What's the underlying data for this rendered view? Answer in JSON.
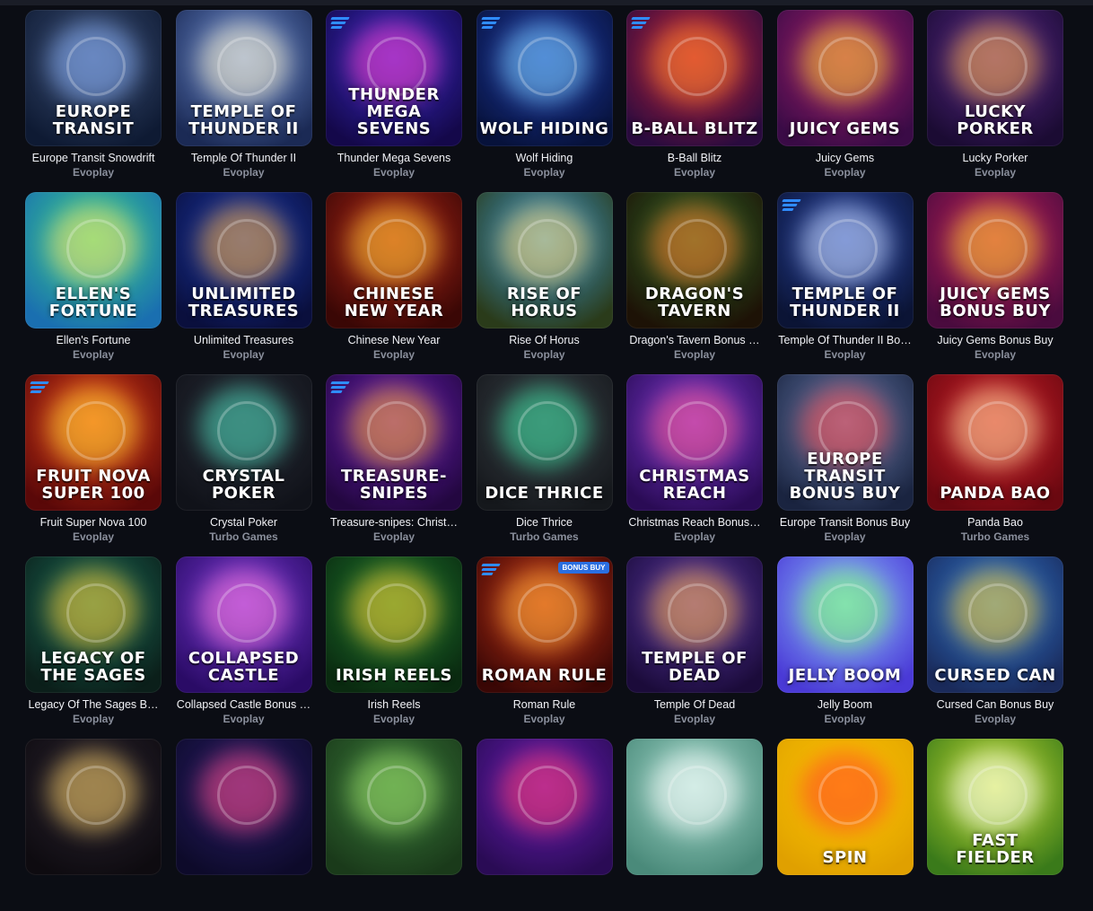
{
  "games": [
    {
      "name": "Europe Transit Snowdrift",
      "provider": "Evoplay",
      "art": "EUROPE TRANSIT",
      "bg": [
        "#3c4f75",
        "#0e1a33"
      ],
      "glow": "#8fb7ff",
      "brand": false,
      "badge": ""
    },
    {
      "name": "Temple Of Thunder II",
      "provider": "Evoplay",
      "art": "TEMPLE OF THUNDER II",
      "bg": [
        "#6e8fd6",
        "#1b2a55"
      ],
      "glow": "#fff3c8",
      "brand": false,
      "badge": ""
    },
    {
      "name": "Thunder Mega Sevens",
      "provider": "Evoplay",
      "art": "THUNDER MEGA SEVENS",
      "bg": [
        "#3a2cc8",
        "#14084a"
      ],
      "glow": "#ff3fc7",
      "brand": true,
      "badge": ""
    },
    {
      "name": "Wolf Hiding",
      "provider": "Evoplay",
      "art": "WOLF HIDING",
      "bg": [
        "#1f3aa6",
        "#07123b"
      ],
      "glow": "#7fd3ff",
      "brand": true,
      "badge": ""
    },
    {
      "name": "B-Ball Blitz",
      "provider": "Evoplay",
      "art": "B-BALL BLITZ",
      "bg": [
        "#c2223a",
        "#2a0b3e"
      ],
      "glow": "#ff8a2b",
      "brand": true,
      "badge": ""
    },
    {
      "name": "Juicy Gems",
      "provider": "Evoplay",
      "art": "JUICY GEMS",
      "bg": [
        "#a81f6e",
        "#3a0b46"
      ],
      "glow": "#ffd12b",
      "brand": false,
      "badge": ""
    },
    {
      "name": "Lucky Porker",
      "provider": "Evoplay",
      "art": "LUCKY PORKER",
      "bg": [
        "#5a2a8c",
        "#1b0b33"
      ],
      "glow": "#ffb347",
      "brand": false,
      "badge": ""
    },
    {
      "name": "Ellen's Fortune",
      "provider": "Evoplay",
      "art": "ELLEN'S FORTUNE",
      "bg": [
        "#3ad38a",
        "#1a6fb0"
      ],
      "glow": "#ffe36b",
      "brand": false,
      "badge": ""
    },
    {
      "name": "Unlimited Treasures",
      "provider": "Evoplay",
      "art": "UNLIMITED TREASURES",
      "bg": [
        "#1b3bb0",
        "#0a0f3d"
      ],
      "glow": "#ffb23b",
      "brand": false,
      "badge": ""
    },
    {
      "name": "Chinese New Year",
      "provider": "Evoplay",
      "art": "CHINESE NEW YEAR",
      "bg": [
        "#b4281a",
        "#3a0705"
      ],
      "glow": "#ffcc33",
      "brand": false,
      "badge": ""
    },
    {
      "name": "Rise Of Horus",
      "provider": "Evoplay",
      "art": "RISE OF HORUS",
      "bg": [
        "#3d9bd6",
        "#2a3b1a"
      ],
      "glow": "#ffd36b",
      "brand": false,
      "badge": ""
    },
    {
      "name": "Dragon's Tavern Bonus …",
      "provider": "Evoplay",
      "art": "DRAGON'S TAVERN",
      "bg": [
        "#2f6a2a",
        "#1d1206"
      ],
      "glow": "#ff7b2b",
      "brand": false,
      "badge": ""
    },
    {
      "name": "Temple Of Thunder II Bo…",
      "provider": "Evoplay",
      "art": "TEMPLE OF THUNDER II",
      "bg": [
        "#2a47a8",
        "#0b1435"
      ],
      "glow": "#cfe0ff",
      "brand": true,
      "badge": ""
    },
    {
      "name": "Juicy Gems Bonus Buy",
      "provider": "Evoplay",
      "art": "JUICY GEMS BONUS BUY",
      "bg": [
        "#c2205b",
        "#4a0b3e"
      ],
      "glow": "#ffd12b",
      "brand": false,
      "badge": ""
    },
    {
      "name": "Fruit Super Nova 100",
      "provider": "Evoplay",
      "art": "FRUIT NOVA SUPER 100",
      "bg": [
        "#e8421c",
        "#5a0808"
      ],
      "glow": "#ffdd33",
      "brand": true,
      "badge": ""
    },
    {
      "name": "Crystal Poker",
      "provider": "Turbo Games",
      "art": "CRYSTAL POKER",
      "bg": [
        "#2a2d38",
        "#101219"
      ],
      "glow": "#4fe0c0",
      "brand": false,
      "badge": ""
    },
    {
      "name": "Treasure-snipes: Christ…",
      "provider": "Evoplay",
      "art": "TREASURE-SNIPES",
      "bg": [
        "#6a1fb8",
        "#230740"
      ],
      "glow": "#ffaf2b",
      "brand": true,
      "badge": ""
    },
    {
      "name": "Dice Thrice",
      "provider": "Turbo Games",
      "art": "DICE THRICE",
      "bg": [
        "#3b4148",
        "#15181c"
      ],
      "glow": "#3ee6a6",
      "brand": false,
      "badge": ""
    },
    {
      "name": "Christmas Reach Bonus…",
      "provider": "Evoplay",
      "art": "CHRISTMAS REACH",
      "bg": [
        "#7d3bd6",
        "#2a0b55"
      ],
      "glow": "#ff5a8a",
      "brand": false,
      "badge": ""
    },
    {
      "name": "Europe Transit Bonus Buy",
      "provider": "Evoplay",
      "art": "EUROPE TRANSIT BONUS BUY",
      "bg": [
        "#6a7eb0",
        "#1a2440"
      ],
      "glow": "#ff4b4b",
      "brand": false,
      "badge": ""
    },
    {
      "name": "Panda Bao",
      "provider": "Turbo Games",
      "art": "PANDA BAO",
      "bg": [
        "#d01f2a",
        "#6a0810"
      ],
      "glow": "#ffe0a0",
      "brand": false,
      "badge": ""
    },
    {
      "name": "Legacy Of The Sages B…",
      "provider": "Evoplay",
      "art": "LEGACY OF THE SAGES",
      "bg": [
        "#1b6e5a",
        "#0b1f1a"
      ],
      "glow": "#ffcc33",
      "brand": false,
      "badge": ""
    },
    {
      "name": "Collapsed Castle Bonus …",
      "provider": "Evoplay",
      "art": "COLLAPSED CASTLE",
      "bg": [
        "#7a3bd6",
        "#2a0b66"
      ],
      "glow": "#ff7ad9",
      "brand": false,
      "badge": ""
    },
    {
      "name": "Irish Reels",
      "provider": "Evoplay",
      "art": "IRISH REELS",
      "bg": [
        "#1f7a2f",
        "#0a2a10"
      ],
      "glow": "#ffcf33",
      "brand": false,
      "badge": ""
    },
    {
      "name": "Roman Rule",
      "provider": "Evoplay",
      "art": "ROMAN RULE",
      "bg": [
        "#c23418",
        "#3a0705"
      ],
      "glow": "#ffb23b",
      "brand": true,
      "badge": "BONUS BUY"
    },
    {
      "name": "Temple Of Dead",
      "provider": "Evoplay",
      "art": "TEMPLE OF DEAD",
      "bg": [
        "#5b3aa8",
        "#1b0b3a"
      ],
      "glow": "#ffb347",
      "brand": false,
      "badge": ""
    },
    {
      "name": "Jelly Boom",
      "provider": "Evoplay",
      "art": "JELLY BOOM",
      "bg": [
        "#8fc0ff",
        "#4a3ad6"
      ],
      "glow": "#7bff6b",
      "brand": false,
      "badge": ""
    },
    {
      "name": "Cursed Can Bonus Buy",
      "provider": "Evoplay",
      "art": "CURSED CAN",
      "bg": [
        "#2f7ad6",
        "#1a2a5a"
      ],
      "glow": "#ffd12b",
      "brand": false,
      "badge": ""
    },
    {
      "name": "",
      "provider": "",
      "art": "",
      "bg": [
        "#2a2430",
        "#0e0b10"
      ],
      "glow": "#ffd36b",
      "brand": false,
      "badge": ""
    },
    {
      "name": "",
      "provider": "",
      "art": "",
      "bg": [
        "#2a1f6a",
        "#0d0a2a"
      ],
      "glow": "#ff4b8a",
      "brand": false,
      "badge": ""
    },
    {
      "name": "",
      "provider": "",
      "art": "",
      "bg": [
        "#3a7a3a",
        "#1a3a1a"
      ],
      "glow": "#9fe06b",
      "brand": false,
      "badge": ""
    },
    {
      "name": "",
      "provider": "",
      "art": "",
      "bg": [
        "#6a1fb8",
        "#2a0b55"
      ],
      "glow": "#ff3b6b",
      "brand": false,
      "badge": ""
    },
    {
      "name": "",
      "provider": "",
      "art": "",
      "bg": [
        "#9fd6c8",
        "#4a8a7a"
      ],
      "glow": "#ffffff",
      "brand": false,
      "badge": ""
    },
    {
      "name": "",
      "provider": "",
      "art": "SPIN",
      "bg": [
        "#ffcc00",
        "#e0a000"
      ],
      "glow": "#ff3b2b",
      "brand": false,
      "badge": ""
    },
    {
      "name": "",
      "provider": "",
      "art": "FAST FIELDER",
      "bg": [
        "#c8e030",
        "#3a7a1a"
      ],
      "glow": "#ffffff",
      "brand": false,
      "badge": ""
    }
  ]
}
